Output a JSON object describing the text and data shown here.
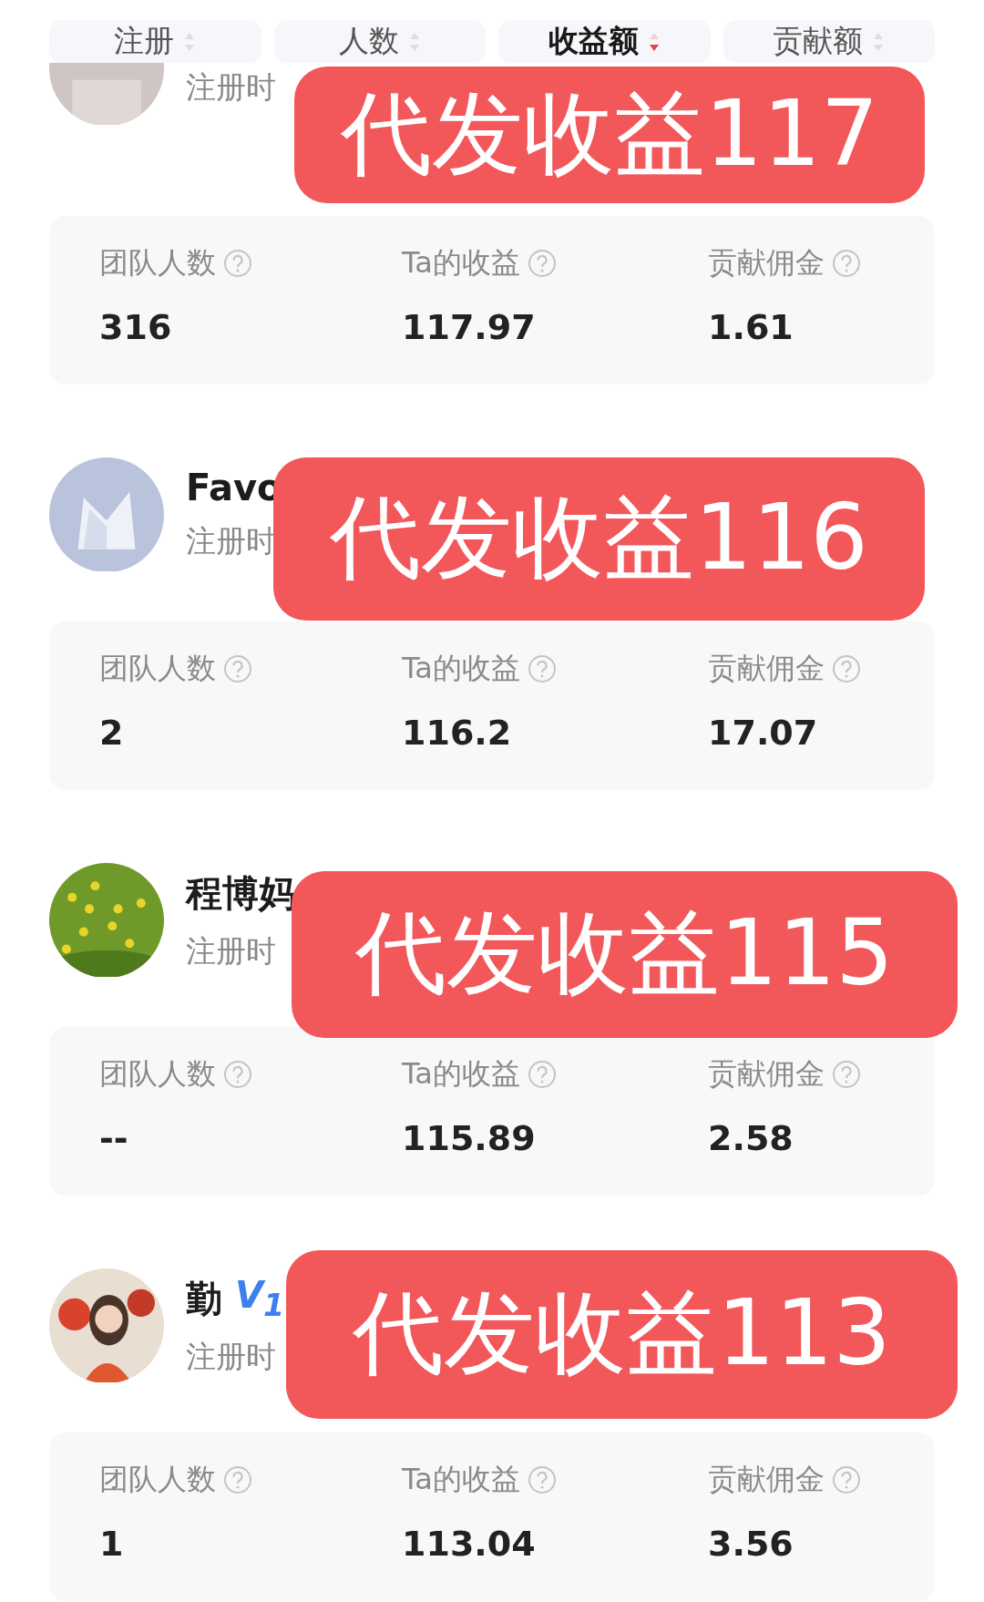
{
  "sort_tabs": [
    {
      "label": "注册",
      "selected": false
    },
    {
      "label": "人数",
      "selected": false
    },
    {
      "label": "收益额",
      "selected": true
    },
    {
      "label": "贡献额",
      "selected": false
    }
  ],
  "members": [
    {
      "registered": "注册时",
      "stats": [
        {
          "label": "团队人数",
          "value": "316"
        },
        {
          "label": "Ta的收益",
          "value": "117.97"
        },
        {
          "label": "贡献佣金",
          "value": "1.61"
        }
      ],
      "overlay": "代发收益117"
    },
    {
      "name": "Favo",
      "registered": "注册时",
      "stats": [
        {
          "label": "团队人数",
          "value": "2"
        },
        {
          "label": "Ta的收益",
          "value": "116.2"
        },
        {
          "label": "贡献佣金",
          "value": "17.07"
        }
      ],
      "overlay": "代发收益116"
    },
    {
      "name": "程博妈",
      "registered": "注册时",
      "stats": [
        {
          "label": "团队人数",
          "value": "--"
        },
        {
          "label": "Ta的收益",
          "value": "115.89"
        },
        {
          "label": "贡献佣金",
          "value": "2.58"
        }
      ],
      "overlay": "代发收益115"
    },
    {
      "name": "勤",
      "badge": "V$_{1}$",
      "registered": "注册时",
      "stats": [
        {
          "label": "团队人数",
          "value": "1"
        },
        {
          "label": "Ta的收益",
          "value": "113.04"
        },
        {
          "label": "贡献佣金",
          "value": "3.56"
        }
      ],
      "overlay": "代发收益113"
    }
  ]
}
